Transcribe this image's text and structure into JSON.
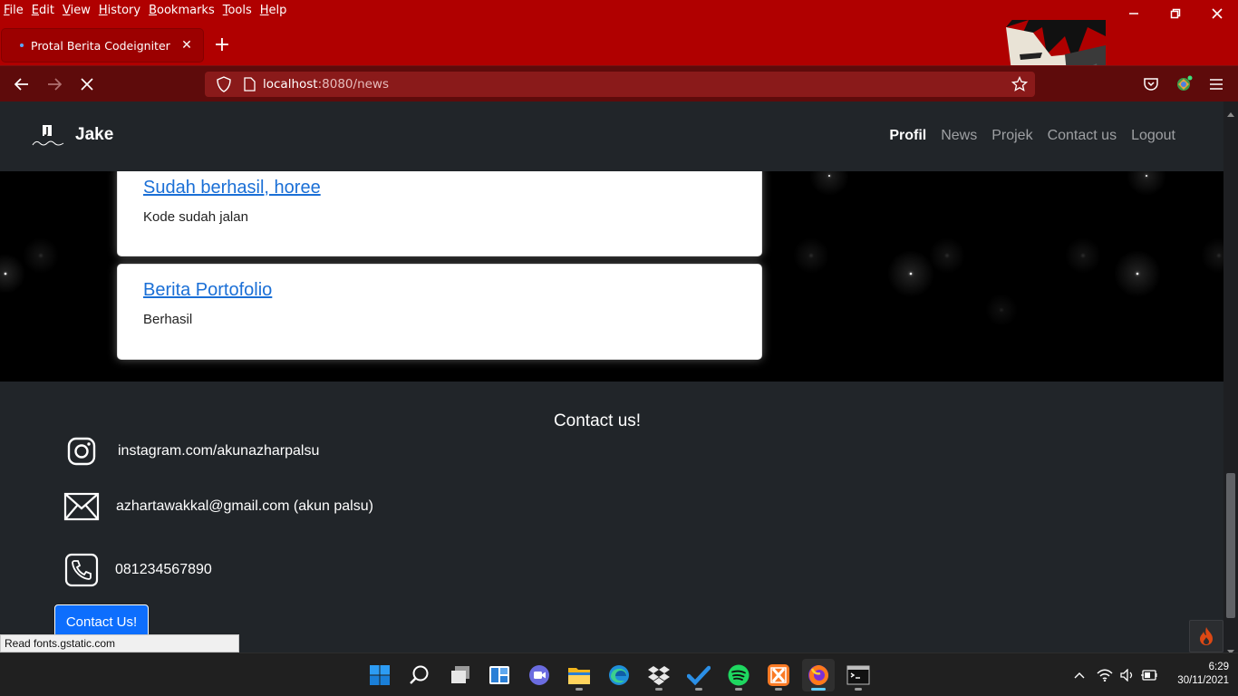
{
  "browser": {
    "menu": [
      "File",
      "Edit",
      "View",
      "History",
      "Bookmarks",
      "Tools",
      "Help"
    ],
    "tab_title": "Protal Berita Codeigniter",
    "url_host": "localhost",
    "url_rest": ":8080/news",
    "status_tip": "Read fonts.gstatic.com"
  },
  "site": {
    "brand": "Jake",
    "nav": [
      "Profil",
      "News",
      "Projek",
      "Contact us",
      "Logout"
    ],
    "active_nav": "Profil"
  },
  "news": [
    {
      "title": "Sudah berhasil, horee",
      "body": "Kode sudah jalan"
    },
    {
      "title": "Berita Portofolio",
      "body": "Berhasil"
    }
  ],
  "footer": {
    "title": "Contact us!",
    "instagram": "instagram.com/akunazharpalsu",
    "email": "azhartawakkal@gmail.com (akun palsu)",
    "phone": "081234567890",
    "button": "Contact Us!"
  },
  "taskbar": {
    "time": "6:29",
    "date": "30/11/2021"
  },
  "colors": {
    "browser_red": "#b00000",
    "nav_dark": "#212529",
    "link_blue": "#1a6fd6",
    "button_blue": "#0d6efd"
  }
}
